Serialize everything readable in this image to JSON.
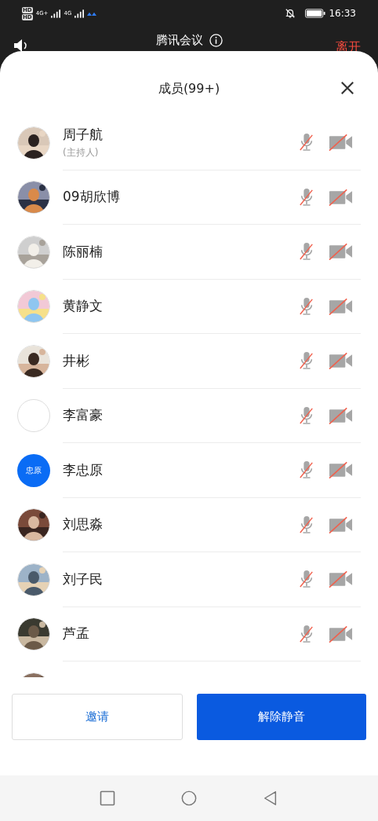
{
  "status_bar": {
    "sim_badges": [
      "HD",
      "HD"
    ],
    "networks": [
      "4G+",
      "4G"
    ],
    "time": "16:33"
  },
  "meeting": {
    "title": "腾讯会议",
    "leave": "离开"
  },
  "sheet": {
    "title": "成员(99+)"
  },
  "members": [
    {
      "name": "周子航",
      "role": "(主持人)",
      "avatar": {
        "kind": "picture"
      },
      "mic_muted": true,
      "camera_off": true
    },
    {
      "name": "09胡欣博",
      "avatar": {
        "kind": "picture"
      },
      "mic_muted": true,
      "camera_off": true
    },
    {
      "name": "陈丽楠",
      "avatar": {
        "kind": "picture"
      },
      "mic_muted": true,
      "camera_off": true
    },
    {
      "name": "黄静文",
      "avatar": {
        "kind": "picture"
      },
      "mic_muted": true,
      "camera_off": true
    },
    {
      "name": "井彬",
      "avatar": {
        "kind": "picture"
      },
      "mic_muted": true,
      "camera_off": true
    },
    {
      "name": "李富豪",
      "avatar": {
        "kind": "empty"
      },
      "mic_muted": true,
      "camera_off": true
    },
    {
      "name": "李忠原",
      "avatar": {
        "kind": "initials",
        "text": "忠原"
      },
      "mic_muted": true,
      "camera_off": true
    },
    {
      "name": "刘思淼",
      "avatar": {
        "kind": "picture"
      },
      "mic_muted": true,
      "camera_off": true
    },
    {
      "name": "刘子民",
      "avatar": {
        "kind": "picture"
      },
      "mic_muted": true,
      "camera_off": true
    },
    {
      "name": "芦孟",
      "avatar": {
        "kind": "picture"
      },
      "mic_muted": true,
      "camera_off": true
    },
    {
      "avatar": {
        "kind": "picture"
      }
    }
  ],
  "buttons": {
    "invite": "邀请",
    "unmute_all": "解除静音"
  }
}
